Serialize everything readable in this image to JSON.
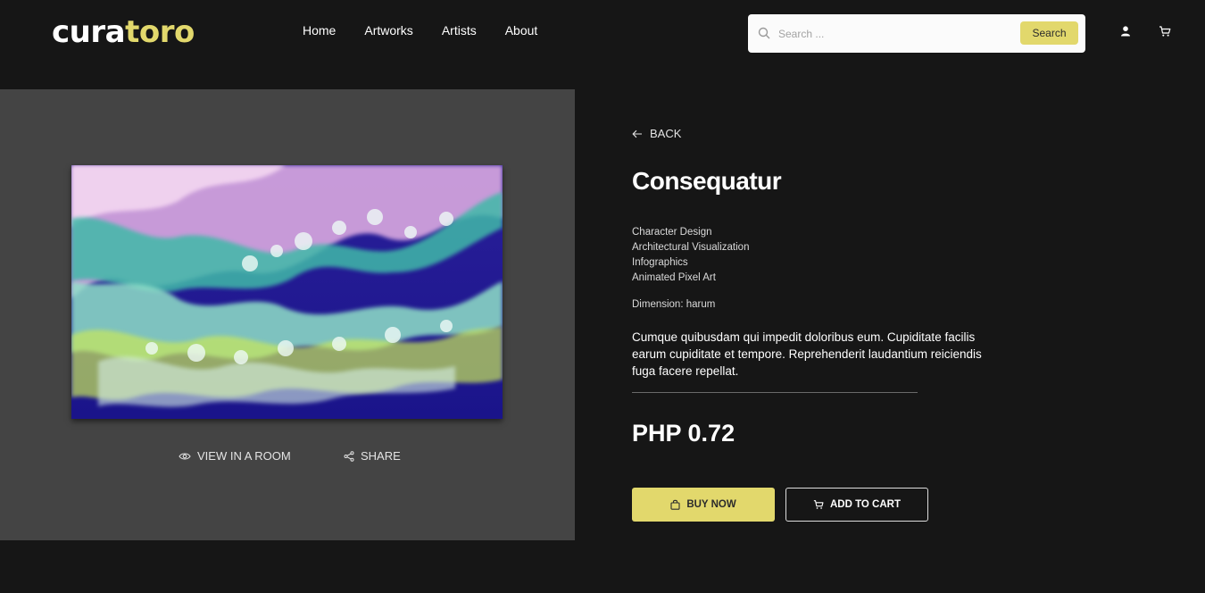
{
  "header": {
    "logo_part1": "cura",
    "logo_part2": "toro",
    "nav": [
      "Home",
      "Artworks",
      "Artists",
      "About"
    ],
    "search": {
      "placeholder": "Search ...",
      "button_label": "Search"
    }
  },
  "artwork_panel": {
    "view_in_room_label": "VIEW IN A ROOM",
    "share_label": "SHARE"
  },
  "detail": {
    "back_label": "BACK",
    "title": "Consequatur",
    "categories": [
      "Character Design",
      "Architectural Visualization",
      "Infographics",
      "Animated Pixel Art"
    ],
    "dimension": "Dimension: harum",
    "description": "Cumque quibusdam qui impedit doloribus eum. Cupiditate facilis earum cupiditate et tempore. Reprehenderit laudantium reiciendis fuga facere repellat.",
    "price": "PHP 0.72",
    "buy_label": "BUY NOW",
    "cart_label": "ADD TO CART"
  },
  "colors": {
    "accent": "#e2d86c",
    "background": "#161616",
    "panel": "#444444"
  },
  "icons": [
    "search-icon",
    "user-icon",
    "cart-icon",
    "arrow-left-icon",
    "eye-icon",
    "share-icon",
    "bag-icon"
  ]
}
